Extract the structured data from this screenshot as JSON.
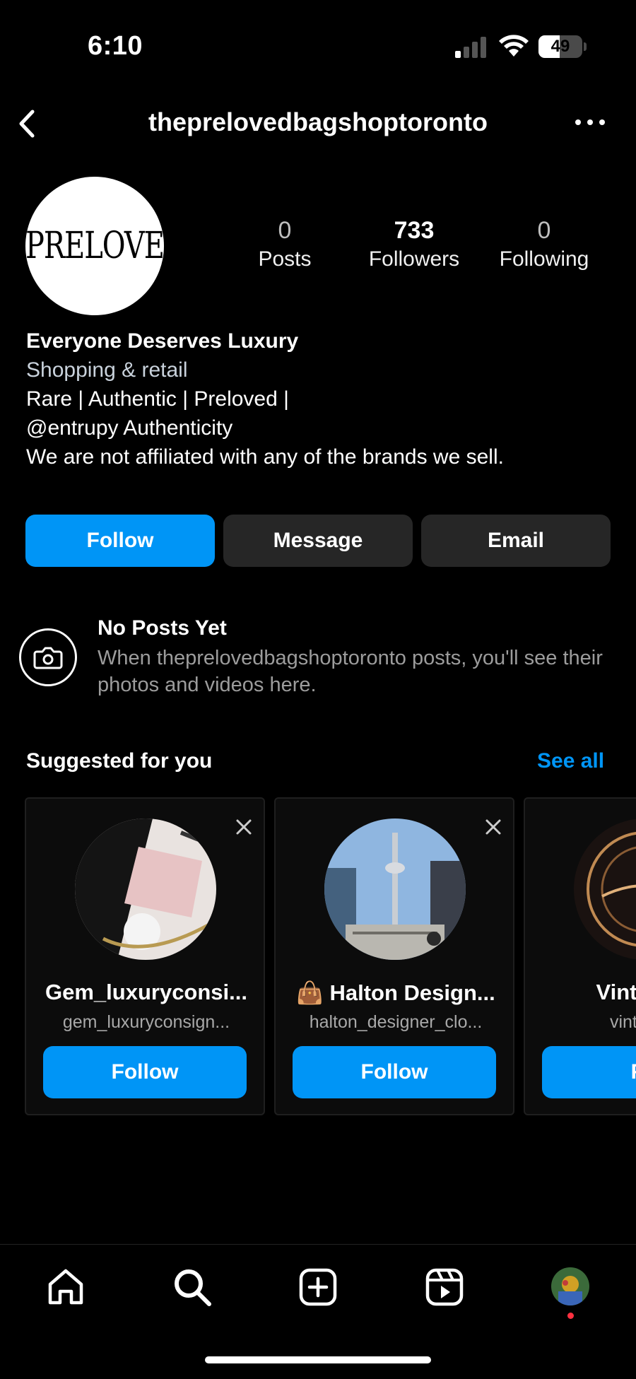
{
  "status_bar": {
    "time": "6:10",
    "battery": "49",
    "battery_level": 0.49
  },
  "header": {
    "username": "theprelovedbagshoptoronto"
  },
  "profile": {
    "avatar_logo": "PRELOVED",
    "stats": [
      {
        "value": "0",
        "label": "Posts"
      },
      {
        "value": "733",
        "label": "Followers"
      },
      {
        "value": "0",
        "label": "Following"
      }
    ],
    "bio": {
      "name": "Everyone Deserves Luxury",
      "category": "Shopping & retail",
      "line1": "Rare | Authentic | Preloved |",
      "line2": "@entrupy Authenticity",
      "line3": "We are not affiliated with any of the brands we sell."
    }
  },
  "actions": {
    "follow": "Follow",
    "message": "Message",
    "email": "Email"
  },
  "empty_state": {
    "title": "No Posts Yet",
    "description": "When theprelovedbagshoptoronto posts, you'll see their photos and videos here."
  },
  "suggested": {
    "title": "Suggested for you",
    "see_all": "See all",
    "cards": [
      {
        "name": "Gem_luxuryconsi...",
        "handle": "gem_luxuryconsign...",
        "button": "Follow"
      },
      {
        "name": "👜 Halton Design...",
        "handle": "halton_designer_clo...",
        "button": "Follow"
      },
      {
        "name": "Vintage L",
        "handle": "vintagelu",
        "button": "Fo"
      }
    ]
  },
  "tab_bar": {
    "items": [
      "home-icon",
      "search-icon",
      "create-icon",
      "reels-icon",
      "profile-avatar"
    ]
  },
  "colors": {
    "accent": "#0095f6",
    "secondary_button": "#262626",
    "notification": "#ff3040"
  }
}
